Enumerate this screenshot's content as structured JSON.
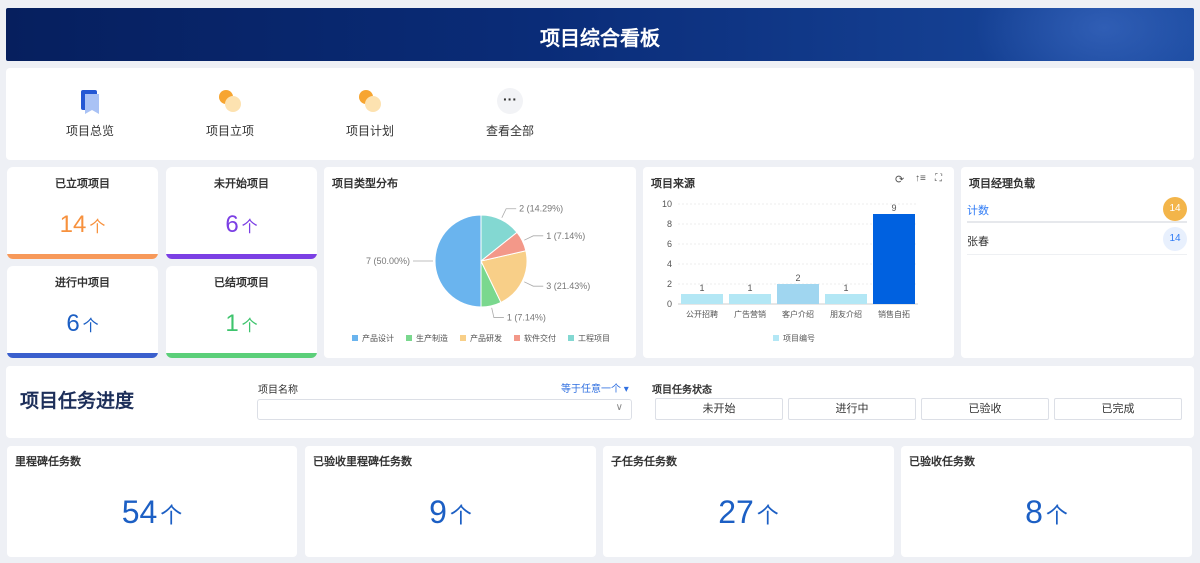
{
  "header": {
    "title": "项目综合看板"
  },
  "shortcuts": [
    {
      "label": "项目总览",
      "icon": "document-icon"
    },
    {
      "label": "项目立项",
      "icon": "project-setup-icon"
    },
    {
      "label": "项目计划",
      "icon": "plan-clock-icon"
    },
    {
      "label": "查看全部",
      "icon": "more-icon"
    }
  ],
  "stats": [
    {
      "title": "已立项项目",
      "value": "14",
      "unit": "个",
      "color": "#f7913d",
      "bar": "#f7995a"
    },
    {
      "title": "未开始项目",
      "value": "6",
      "unit": "个",
      "color": "#7b3fe4",
      "bar": "#7b3fe4"
    },
    {
      "title": "进行中项目",
      "value": "6",
      "unit": "个",
      "color": "#1c5fc4",
      "bar": "#3a5fcd"
    },
    {
      "title": "已结项项目",
      "value": "1",
      "unit": "个",
      "color": "#3ec46d",
      "bar": "#5bcf79"
    }
  ],
  "chart_data": [
    {
      "type": "pie",
      "title": "项目类型分布",
      "categories": [
        "产品设计",
        "生产制造",
        "产品研发",
        "软件交付",
        "工程项目"
      ],
      "values": [
        7,
        1,
        3,
        1,
        2
      ],
      "labels": [
        "7 (50.00%)",
        "1 (7.14%)",
        "3 (21.43%)",
        "1 (7.14%)",
        "2 (14.29%)"
      ],
      "colors": [
        "#6ab4ee",
        "#7ad88e",
        "#f8cf88",
        "#f39889",
        "#83d8d2"
      ],
      "legend": "bottom"
    },
    {
      "type": "bar",
      "title": "项目来源",
      "categories": [
        "公开招聘",
        "广告营销",
        "客户介绍",
        "朋友介绍",
        "销售自拓"
      ],
      "values": [
        1,
        1,
        2,
        1,
        9
      ],
      "colors": [
        "#b3e7f5",
        "#b3e7f5",
        "#a0d6f0",
        "#b3e7f5",
        "#0061e0"
      ],
      "ylim": [
        0,
        10
      ],
      "yticks": [
        "0",
        "2",
        "4",
        "6",
        "8",
        "10"
      ],
      "legend_label": "项目编号",
      "legend": "bottom"
    }
  ],
  "manager": {
    "title": "项目经理负载",
    "rows": [
      {
        "name": "计数",
        "count": "14"
      },
      {
        "name": "张春",
        "count": "14"
      }
    ]
  },
  "tasks": {
    "title": "项目任务进度",
    "filter_label": "项目名称",
    "filter_mode": "等于任意一个",
    "filter_value": "",
    "status_label": "项目任务状态",
    "status_options": [
      "未开始",
      "进行中",
      "已验收",
      "已完成"
    ]
  },
  "task_stats": [
    {
      "title": "里程碑任务数",
      "value": "54",
      "unit": "个"
    },
    {
      "title": "已验收里程碑任务数",
      "value": "9",
      "unit": "个"
    },
    {
      "title": "子任务任务数",
      "value": "27",
      "unit": "个"
    },
    {
      "title": "已验收任务数",
      "value": "8",
      "unit": "个"
    }
  ]
}
